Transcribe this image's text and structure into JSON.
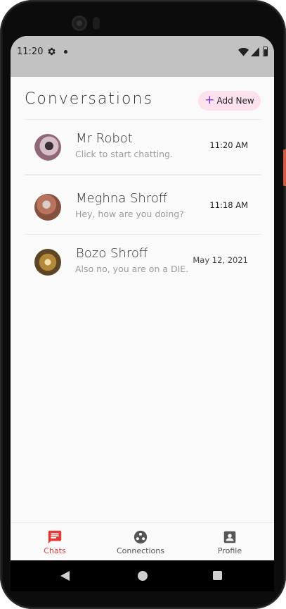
{
  "status_bar": {
    "time": "11:20",
    "icons": [
      "settings-icon",
      "notification-dot-icon",
      "wifi-icon",
      "signal-icon",
      "battery-icon"
    ]
  },
  "header": {
    "title": "Conversations",
    "add_button_label": "Add New",
    "add_icon": "plus-icon"
  },
  "conversations": [
    {
      "name": "Mr Robot",
      "preview": "Click to start chatting.",
      "time": "11:20 AM"
    },
    {
      "name": "Meghna Shroff",
      "preview": "Hey, how are you doing?",
      "time": "11:18 AM"
    },
    {
      "name": "Bozo Shroff",
      "preview": "Also no, you are on a DIE...",
      "time": "May 12, 2021"
    }
  ],
  "bottom_nav": {
    "items": [
      {
        "label": "Chats",
        "icon": "chat-icon",
        "active": true
      },
      {
        "label": "Connections",
        "icon": "connections-icon",
        "active": false
      },
      {
        "label": "Profile",
        "icon": "profile-icon",
        "active": false
      }
    ]
  },
  "colors": {
    "accent": "#e53935",
    "add_button_bg": "#fde1ec",
    "add_icon": "#7a2ccc",
    "status_bar_bg": "#c2c2c2"
  }
}
